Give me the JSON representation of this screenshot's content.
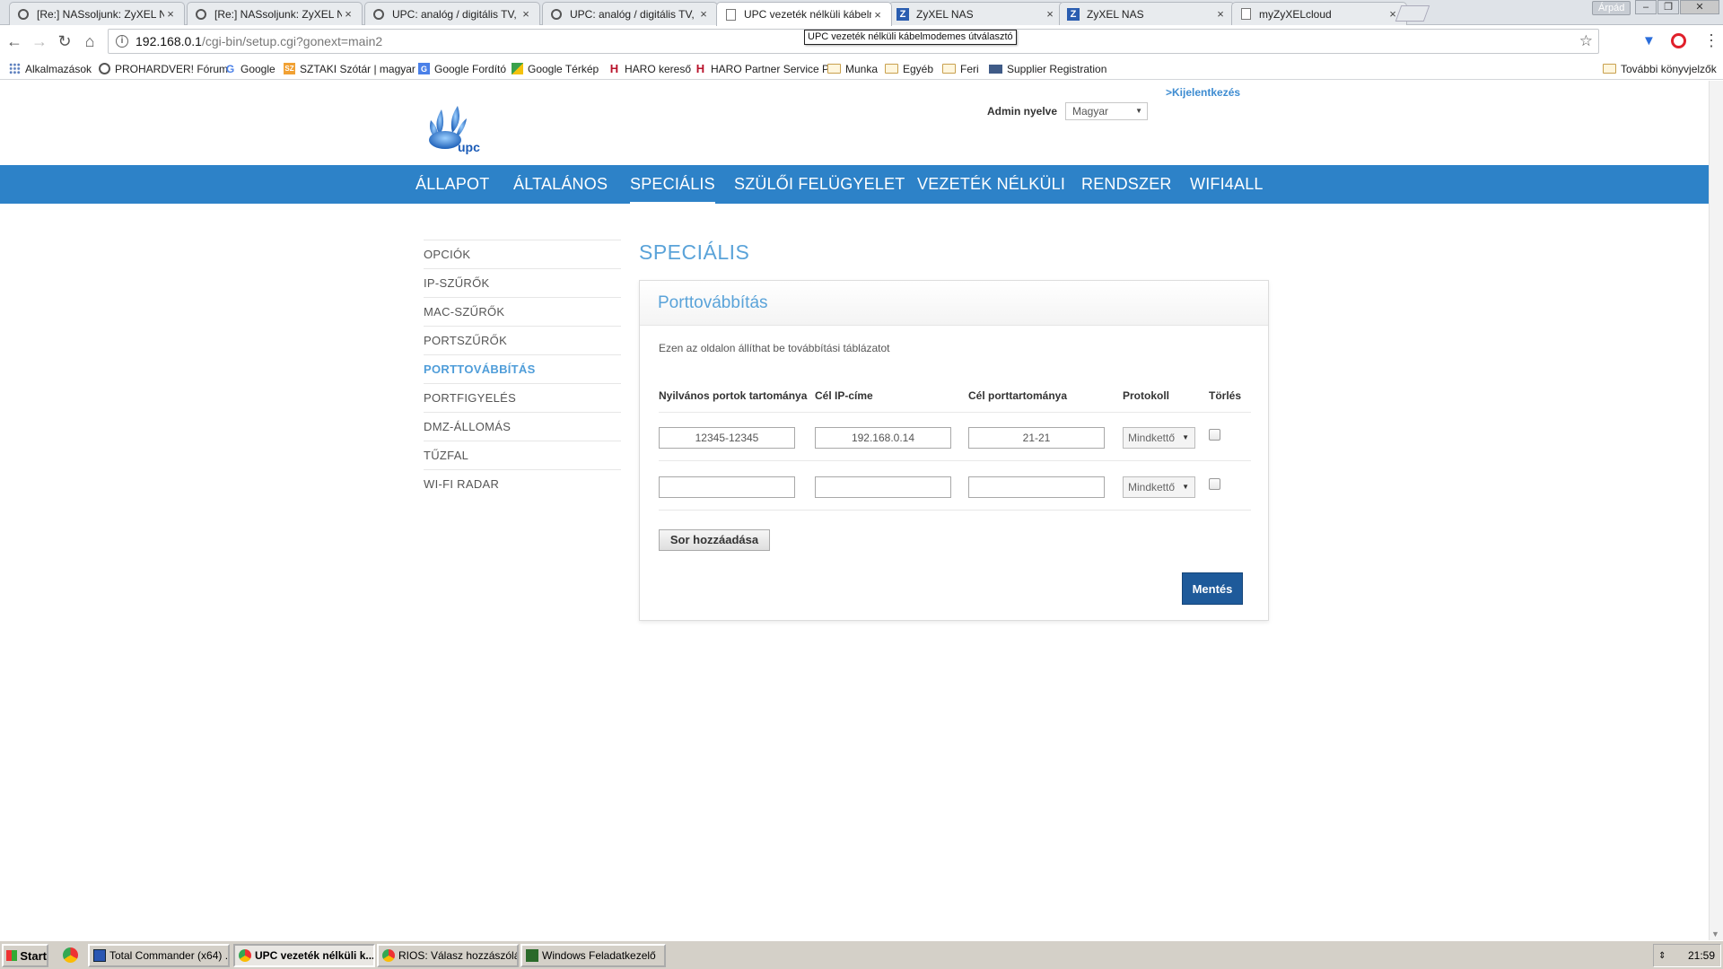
{
  "browser": {
    "tabs": [
      {
        "title": "[Re:] NASsoljunk: ZyXEL N",
        "fav": "q"
      },
      {
        "title": "[Re:] NASsoljunk: ZyXEL N",
        "fav": "q"
      },
      {
        "title": "UPC: analóg / digitális TV,",
        "fav": "q"
      },
      {
        "title": "UPC: analóg / digitális TV,",
        "fav": "q"
      },
      {
        "title": "UPC vezeték nélküli kábelm",
        "fav": "doc"
      },
      {
        "title": "ZyXEL NAS",
        "fav": "z"
      },
      {
        "title": "ZyXEL NAS",
        "fav": "z"
      },
      {
        "title": "myZyXELcloud",
        "fav": "doc"
      }
    ],
    "active_tab": 4,
    "user": "Árpád",
    "url_host": "192.168.0.1",
    "url_path": "/cgi-bin/setup.cgi?gonext=main2",
    "tooltip": "UPC vezeték nélküli kábelmodemes útválasztó",
    "bookmarks": [
      {
        "label": "Alkalmazások",
        "icon": "grid"
      },
      {
        "label": "PROHARDVER! Fórum",
        "icon": "q"
      },
      {
        "label": "Google",
        "icon": "g"
      },
      {
        "label": "SZTAKI Szótár | magyar",
        "icon": "sz"
      },
      {
        "label": "Google Fordító",
        "icon": "trans"
      },
      {
        "label": "Google Térkép",
        "icon": "map"
      },
      {
        "label": "HARO kereső",
        "icon": "h"
      },
      {
        "label": "HARO Partner Service P",
        "icon": "h"
      },
      {
        "label": "Munka",
        "icon": "folder"
      },
      {
        "label": "Egyéb",
        "icon": "folder"
      },
      {
        "label": "Feri",
        "icon": "folder"
      },
      {
        "label": "Supplier Registration",
        "icon": "sup"
      }
    ],
    "other_bookmarks": "További könyvjelzők"
  },
  "router": {
    "logo_text": "upc",
    "logout": ">Kijelentkezés",
    "lang_label": "Admin nyelve",
    "lang_value": "Magyar",
    "nav": [
      "ÁLLAPOT",
      "ÁLTALÁNOS",
      "SPECIÁLIS",
      "SZÜLŐI FELÜGYELET",
      "VEZETÉK NÉLKÜLI",
      "RENDSZER",
      "WIFI4ALL"
    ],
    "nav_active": 2,
    "side": [
      "OPCIÓK",
      "IP-SZŰRŐK",
      "MAC-SZŰRŐK",
      "PORTSZŰRŐK",
      "PORTTOVÁBBÍTÁS",
      "PORTFIGYELÉS",
      "DMZ-ÁLLOMÁS",
      "TŰZFAL",
      "WI-FI RADAR"
    ],
    "side_active": 4,
    "section_title": "SPECIÁLIS",
    "panel_title": "Porttovábbítás",
    "panel_desc": "Ezen az oldalon állíthat be továbbítási táblázatot",
    "columns": [
      "Nyilvános portok tartománya",
      "Cél IP-címe",
      "Cél porttartománya",
      "Protokoll",
      "Törlés"
    ],
    "rows": [
      {
        "public_ports": "12345-12345",
        "target_ip": "192.168.0.14",
        "target_ports": "21-21",
        "protocol": "Mindkettő",
        "delete": false
      },
      {
        "public_ports": "",
        "target_ip": "",
        "target_ports": "",
        "protocol": "Mindkettő",
        "delete": false
      }
    ],
    "add_row": "Sor hozzáadása",
    "save": "Mentés"
  },
  "taskbar": {
    "start": "Start",
    "items": [
      {
        "label": "Total Commander (x64) ...",
        "icon": "tc",
        "active": false
      },
      {
        "label": "UPC vezeték nélküli k...",
        "icon": "chrome",
        "active": true
      },
      {
        "label": "RIOS: Válasz hozzászólá...",
        "icon": "chrome",
        "active": false
      },
      {
        "label": "Windows Feladatkezelő",
        "icon": "tm",
        "active": false
      }
    ],
    "clock": "21:59"
  }
}
